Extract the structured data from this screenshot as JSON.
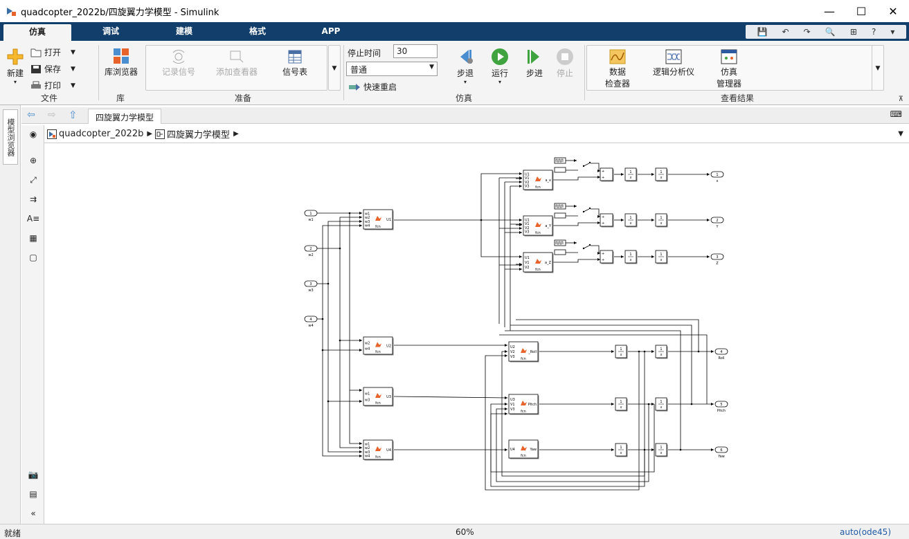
{
  "window": {
    "title": "quadcopter_2022b/四旋翼力学模型 - Simulink",
    "controls": {
      "minimize": "—",
      "maximize": "☐",
      "close": "✕"
    }
  },
  "menu": {
    "tabs": [
      {
        "label": "仿真",
        "active": true
      },
      {
        "label": "调试"
      },
      {
        "label": "建模"
      },
      {
        "label": "格式"
      },
      {
        "label": "APP"
      }
    ]
  },
  "ribbon": {
    "file": {
      "label": "文件",
      "new": "新建",
      "open": "打开",
      "save": "保存",
      "print": "打印"
    },
    "library": {
      "label": "库",
      "browser": "库浏览器"
    },
    "prepare": {
      "label": "准备",
      "log_signals": "记录信号",
      "add_viewer": "添加查看器",
      "signal_table": "信号表"
    },
    "simulate": {
      "label": "仿真",
      "stop_time_label": "停止时间",
      "stop_time_value": "30",
      "mode": "普通",
      "fast_restart": "快速重启",
      "step_back": "步退",
      "run": "运行",
      "step_forward": "步进",
      "stop": "停止"
    },
    "review": {
      "label": "查看结果",
      "data_inspector_1": "数据",
      "data_inspector_2": "检查器",
      "logic_analyzer": "逻辑分析仪",
      "sim_manager_1": "仿真",
      "sim_manager_2": "管理器"
    }
  },
  "browser": {
    "vertical_tab": "模型浏览器",
    "tab": "四旋翼力学模型"
  },
  "breadcrumb": {
    "root": "quadcopter_2022b",
    "child": "四旋翼力学模型"
  },
  "model": {
    "inports": [
      {
        "num": "1",
        "name": "w1"
      },
      {
        "num": "2",
        "name": "w2"
      },
      {
        "num": "3",
        "name": "w3"
      },
      {
        "num": "4",
        "name": "w4"
      }
    ],
    "fcn_label": "fcn",
    "fcn_blocks": {
      "u1": {
        "in": [
          "w1",
          "w2",
          "w3",
          "w4"
        ],
        "out": "U1"
      },
      "u2": {
        "in": [
          "w2",
          "w4"
        ],
        "out": "U2"
      },
      "u3": {
        "in": [
          "w1",
          "w3"
        ],
        "out": "U3"
      },
      "u4": {
        "in": [
          "w1",
          "w2",
          "w3",
          "w4"
        ],
        "out": "U4"
      },
      "ax": {
        "in": [
          "U1",
          "V1",
          "V2",
          "V3"
        ],
        "out": "a_x"
      },
      "ay": {
        "in": [
          "U1",
          "V1",
          "V2",
          "V3"
        ],
        "out": "a_Y"
      },
      "az": {
        "in": [
          "U1",
          "V1",
          "V2"
        ],
        "out": "a_Z"
      },
      "roll": {
        "in": [
          "U2",
          "V2",
          "V3"
        ],
        "out": "_Roll"
      },
      "pitch": {
        "in": [
          "U3",
          "V1",
          "V3"
        ],
        "out": "Pitch"
      },
      "yaw": {
        "in": [
          "U4"
        ],
        "out": "Yaw"
      }
    },
    "integrator_num": "1",
    "integrator_den": "s",
    "outports": [
      {
        "num": "1",
        "name": "x"
      },
      {
        "num": "2",
        "name": "Y"
      },
      {
        "num": "3",
        "name": "Z"
      },
      {
        "num": "4",
        "name": "Roll"
      },
      {
        "num": "5",
        "name": "Pitch"
      },
      {
        "num": "6",
        "name": "Yaw"
      }
    ]
  },
  "status": {
    "left": "就绪",
    "zoom": "60%",
    "solver": "auto(ode45)"
  }
}
